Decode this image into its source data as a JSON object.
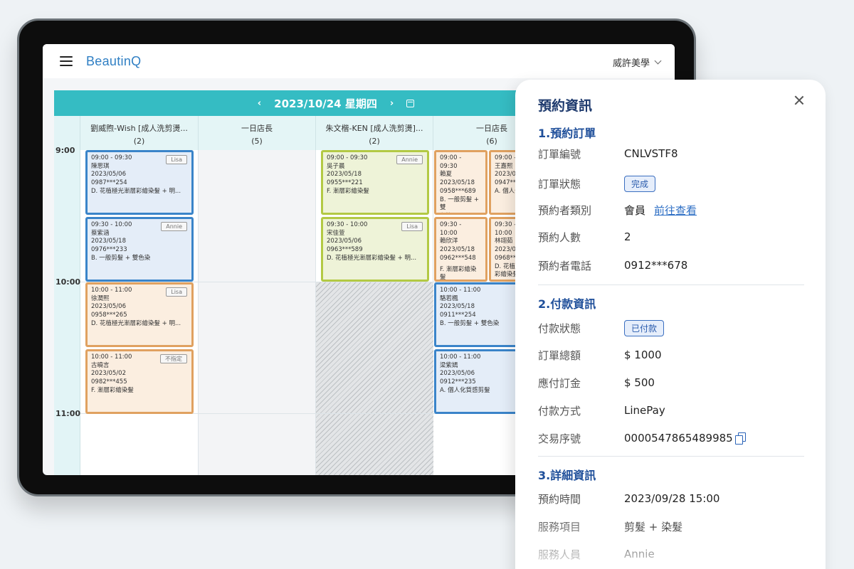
{
  "app": {
    "brand": "BeautinQ",
    "store": "威許美學"
  },
  "calendar": {
    "date": "2023/10/24 星期四",
    "prev": "‹",
    "next": "›",
    "columns": [
      {
        "name": "劉威煦-Wish [成人洗剪燙...",
        "count": "(2)"
      },
      {
        "name": "一日店長",
        "count": "(5)"
      },
      {
        "name": "朱文楷-KEN [成人洗剪燙]...",
        "count": "(2)"
      },
      {
        "name": "一日店長",
        "count": "(6)"
      }
    ],
    "times": [
      "9:00",
      "10:00",
      "11:00"
    ],
    "appointments": [
      {
        "time": "09:00 - 09:30",
        "name": "陳思琪",
        "date": "2023/05/06",
        "phone": "0987***254",
        "service": "D. 花植極光漸層彩繪染髮 + 明...",
        "staff": "Lisa"
      },
      {
        "time": "09:30 - 10:00",
        "name": "蔡紫涵",
        "date": "2023/05/18",
        "phone": "0976***233",
        "service": "B. 一般剪髮 + 雙色染",
        "staff": "Annie"
      },
      {
        "time": "10:00 - 11:00",
        "name": "徐潤熙",
        "date": "2023/05/06",
        "phone": "0958***265",
        "service": "D. 花植極光漸層彩繪染髮 + 明...",
        "staff": "Lisa"
      },
      {
        "time": "10:00 - 11:00",
        "name": "古曉言",
        "date": "2023/05/02",
        "phone": "0982***455",
        "service": "F. 漸層彩繪染髮",
        "staff": "不指定"
      },
      {
        "time": "09:00 - 09:30",
        "name": "吳子晨",
        "date": "2023/05/18",
        "phone": "0955***221",
        "service": "F. 漸層彩繪染髮",
        "staff": "Annie"
      },
      {
        "time": "09:30 - 10:00",
        "name": "宋佳萱",
        "date": "2023/05/06",
        "phone": "0963***589",
        "service": "D. 花植極光漸層彩繪染髮 + 明...",
        "staff": "Lisa"
      },
      {
        "time1": "09:00 -",
        "time2": "09:30",
        "name": "賴夏",
        "date": "2023/05/18",
        "phone": "0958***689",
        "service1": "B. 一般剪髮 + 雙",
        "service2": "色染"
      },
      {
        "time1": "09:00 -",
        "name": "王嘉熙",
        "date": "2023/05/",
        "phone": "0947***",
        "service1": "A. 個人化"
      },
      {
        "time1": "09:30 -",
        "time2": "10:00",
        "name": "賴欣洋",
        "date": "2023/05/18",
        "phone": "0962***548",
        "service1": "F. 漸層彩繪染髮"
      },
      {
        "time1": "09:30 -",
        "time2": "10:00",
        "name": "林翊茹",
        "date": "2023/05/",
        "phone": "0968***",
        "service1": "D. 花植",
        "service2": "彩繪染髮"
      },
      {
        "time": "10:00 - 11:00",
        "name": "駱若楓",
        "date": "2023/05/18",
        "phone": "0911***254",
        "service": "B. 一般剪髮 + 雙色染"
      },
      {
        "time": "10:00 - 11:00",
        "name": "梁紫嫣",
        "date": "2023/05/06",
        "phone": "0912***235",
        "service": "A. 個人化質感剪髮"
      }
    ]
  },
  "panel": {
    "title": "預約資訊",
    "sections": [
      "1.預約訂單",
      "2.付款資訊",
      "3.詳細資訊"
    ],
    "order": {
      "number_label": "訂單編號",
      "number": "CNLVSTF8",
      "status_label": "訂單狀態",
      "status": "完成",
      "type_label": "預約者類別",
      "type": "會員",
      "type_link": "前往查看",
      "count_label": "預約人數",
      "count": "2",
      "phone_label": "預約者電話",
      "phone": "0912***678"
    },
    "payment": {
      "status_label": "付款狀態",
      "status": "已付款",
      "total_label": "訂單總額",
      "total": "$ 1000",
      "deposit_label": "應付訂金",
      "deposit": "$ 500",
      "method_label": "付款方式",
      "method": "LinePay",
      "txn_label": "交易序號",
      "txn": "0000547865489985"
    },
    "detail": {
      "time_label": "預約時間",
      "time": "2023/09/28 15:00",
      "service_label": "服務項目",
      "service": "剪髮 + 染髮",
      "staff_label": "服務人員",
      "staff": "Annie"
    }
  }
}
